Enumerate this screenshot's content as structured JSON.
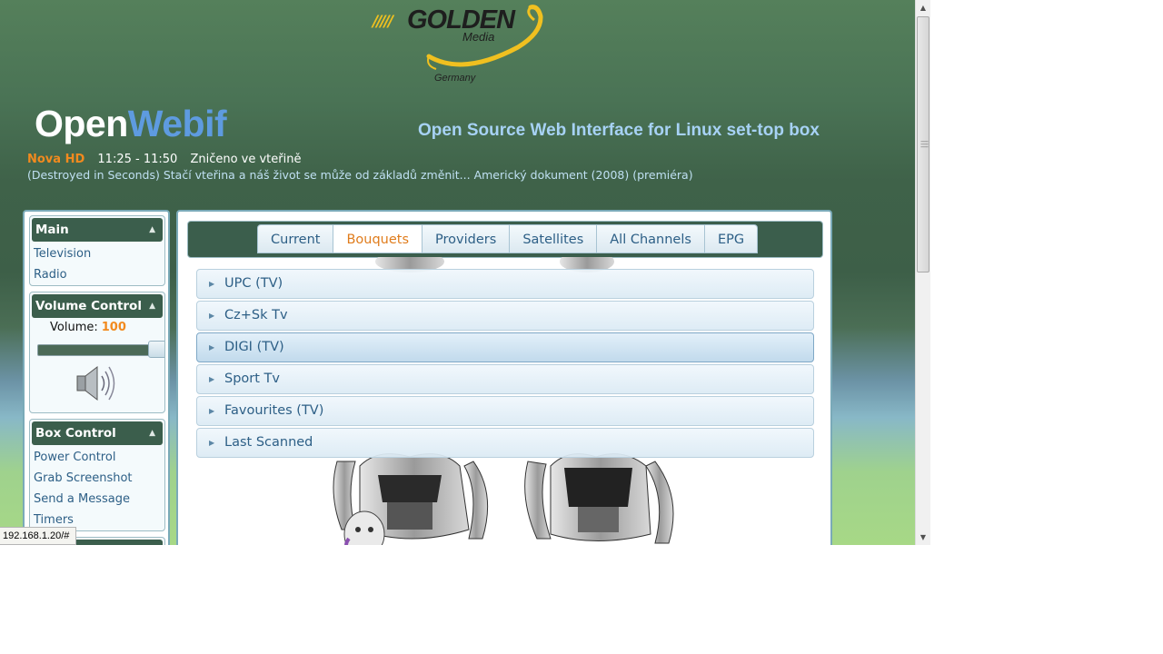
{
  "logo": {
    "brand": "GOLDEN",
    "sub": "Media",
    "country": "Germany"
  },
  "header": {
    "brand_open": "Open",
    "brand_webif": "Webif",
    "tagline": "Open Source Web Interface for Linux set-top box"
  },
  "now_playing": {
    "channel": "Nova HD",
    "time": "11:25 - 11:50",
    "title": "Zničeno ve vteřině",
    "description": "(Destroyed in Seconds) Stačí vteřina a náš život se může od základů změnit... Americký dokument (2008) (premiéra)"
  },
  "sidebar": {
    "main": {
      "title": "Main",
      "items": [
        "Television",
        "Radio"
      ]
    },
    "volume": {
      "title": "Volume Control",
      "label": "Volume:",
      "value": "100",
      "level": 1.0
    },
    "box": {
      "title": "Box Control",
      "items": [
        "Power Control",
        "Grab Screenshot",
        "Send a Message",
        "Timers"
      ]
    }
  },
  "tabs": [
    "Current",
    "Bouquets",
    "Providers",
    "Satellites",
    "All Channels",
    "EPG"
  ],
  "active_tab": "Bouquets",
  "bouquets": [
    "UPC (TV)",
    "Cz+Sk Tv",
    "DIGI (TV)",
    "Sport Tv",
    "Favourites (TV)",
    "Last Scanned"
  ],
  "hovered_bouquet": "DIGI (TV)",
  "status_url": "192.168.1.20/#",
  "colors": {
    "accent_orange": "#f28a1e",
    "link_blue": "#2d5f86",
    "panel_header": "#3b5e4c",
    "brand_blue": "#5e9be0"
  }
}
